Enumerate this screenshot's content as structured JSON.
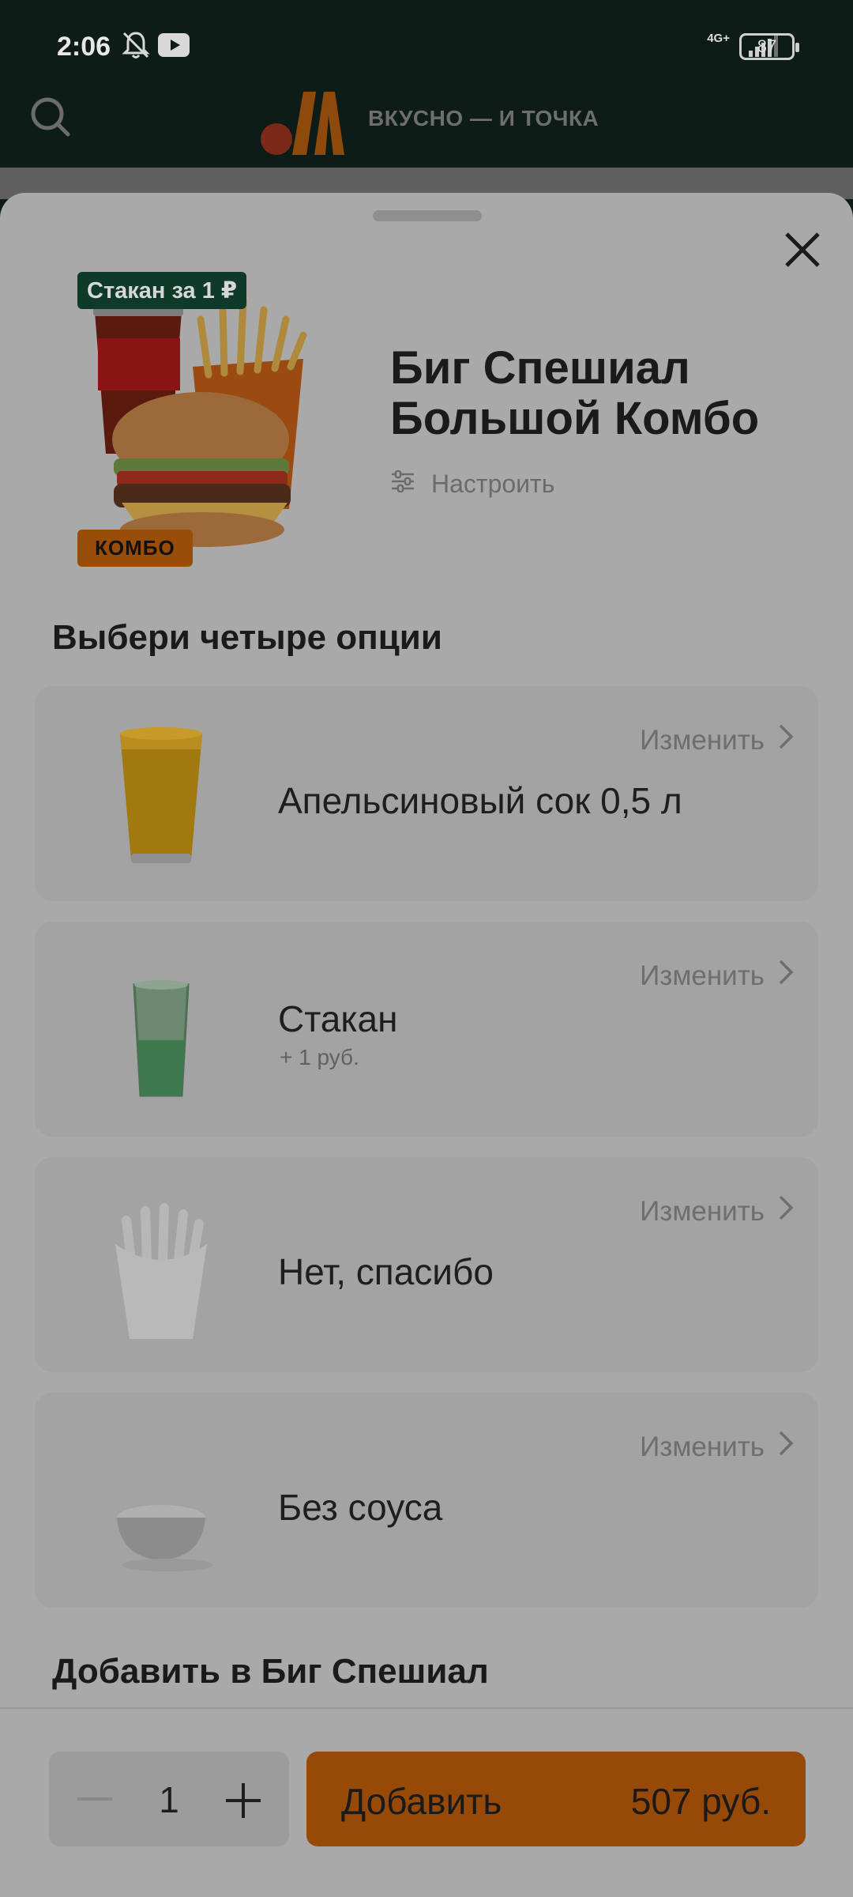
{
  "status": {
    "time": "2:06",
    "network": "4G+",
    "battery": "87"
  },
  "header": {
    "brand": "ВКУСНО — И ТОЧКА"
  },
  "product": {
    "promo_badge": "Стакан за 1 ₽",
    "combo_badge": "КОМБО",
    "title_line1": "Биг Спешиал",
    "title_line2": "Большой Комбо",
    "customize_label": "Настроить"
  },
  "options_section": {
    "title": "Выбери четыре опции",
    "items": [
      {
        "change_label": "Изменить",
        "label": "Апельсиновый сок 0,5 л",
        "sub": ""
      },
      {
        "change_label": "Изменить",
        "label": "Стакан",
        "sub": "+ 1 руб."
      },
      {
        "change_label": "Изменить",
        "label": "Нет, спасибо",
        "sub": ""
      },
      {
        "change_label": "Изменить",
        "label": "Без соуса",
        "sub": ""
      }
    ]
  },
  "add_section": {
    "title": "Добавить в Биг Спешиал"
  },
  "footer": {
    "quantity": "1",
    "add_label": "Добавить",
    "price": "507 руб."
  },
  "colors": {
    "accent": "#974a07",
    "header_bg": "#0d1c17",
    "sheet_bg": "#a9a9a9"
  }
}
